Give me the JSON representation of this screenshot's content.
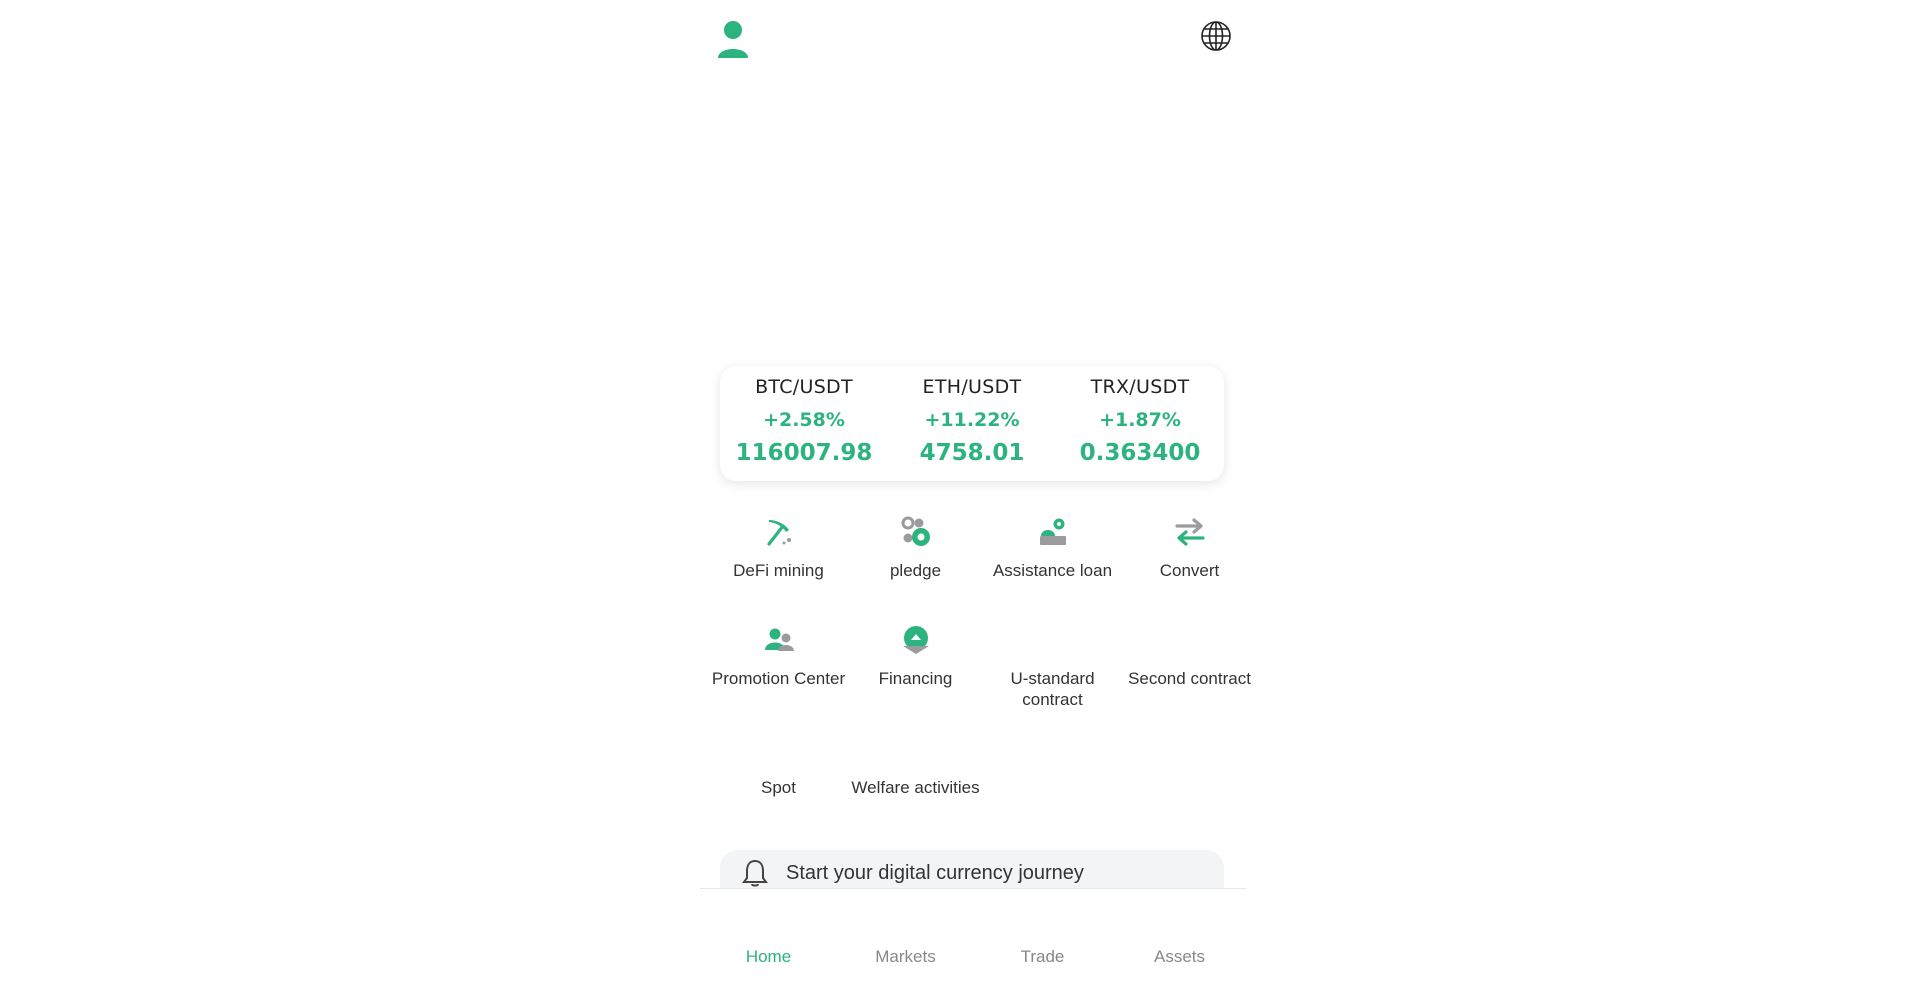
{
  "header": {
    "avatar_icon": "user-icon",
    "language_icon": "globe-icon"
  },
  "colors": {
    "accent": "#2db37f",
    "icon_gray": "#9b9b9f",
    "text": "#333333"
  },
  "tickers": [
    {
      "pair": "BTC/USDT",
      "change": "+2.58%",
      "price": "116007.98"
    },
    {
      "pair": "ETH/USDT",
      "change": "+11.22%",
      "price": "4758.01"
    },
    {
      "pair": "TRX/USDT",
      "change": "+1.87%",
      "price": "0.363400"
    }
  ],
  "features": [
    {
      "label": "DeFi mining",
      "icon": "pickaxe-icon"
    },
    {
      "label": "pledge",
      "icon": "coins-icon"
    },
    {
      "label": "Assistance loan",
      "icon": "loan-icon"
    },
    {
      "label": "Convert",
      "icon": "convert-arrows-icon"
    },
    {
      "label": "Promotion Center",
      "icon": "users-icon"
    },
    {
      "label": "Financing",
      "icon": "financing-icon"
    },
    {
      "label": "U-standard contract",
      "icon": ""
    },
    {
      "label": "Second contract",
      "icon": ""
    },
    {
      "label": "Spot",
      "icon": ""
    },
    {
      "label": "Welfare activities",
      "icon": ""
    }
  ],
  "notice": {
    "icon": "bell-icon",
    "text": "Start your digital currency journey"
  },
  "tabs": [
    {
      "label": "Home",
      "active": true
    },
    {
      "label": "Markets",
      "active": false
    },
    {
      "label": "Trade",
      "active": false
    },
    {
      "label": "Assets",
      "active": false
    }
  ]
}
